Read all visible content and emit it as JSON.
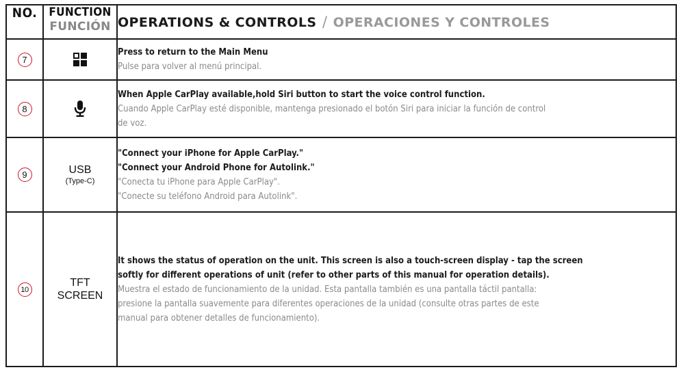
{
  "header": {
    "no": "NO.",
    "function_en": "FUNCTION",
    "function_es": "FUNCIÓN",
    "ops_en": "OPERATIONS & CONTROLS",
    "separator": "/",
    "ops_es": "OPERACIONES Y CONTROLES"
  },
  "rows": [
    {
      "number": "7",
      "function_icon": "main-menu-grid-icon",
      "lines_en": [
        "Press to return to the Main Menu"
      ],
      "lines_es": [
        "Pulse para volver al menú principal."
      ]
    },
    {
      "number": "8",
      "function_icon": "microphone-icon",
      "lines_en": [
        "When Apple CarPlay available,hold Siri button to start the voice control function."
      ],
      "lines_es": [
        "Cuando Apple CarPlay esté disponible, mantenga presionado el botón Siri para iniciar la función de control",
        "de voz."
      ]
    },
    {
      "number": "9",
      "function_main": "USB",
      "function_sub": "(Type-C)",
      "lines_en": [
        "\"Connect your iPhone for Apple CarPlay.\"",
        "\"Connect your Android Phone for Autolink.\""
      ],
      "lines_es": [
        "\"Conecta tu iPhone para Apple CarPlay\".",
        "\"Conecte su teléfono Android para Autolink\"."
      ]
    },
    {
      "number": "10",
      "function_main_1": "TFT",
      "function_main_2": "SCREEN",
      "lines_en": [
        "It shows the status of operation on the unit. This screen is also a touch-screen display - tap the screen",
        "softly for different operations of unit (refer to other parts of this manual for operation details)."
      ],
      "lines_es": [
        "Muestra el estado de funcionamiento de la unidad. Esta pantalla también es una pantalla táctil pantalla:",
        "presione la pantalla suavemente para diferentes operaciones de la unidad (consulte otras partes de este",
        "manual para obtener detalles de funcionamiento)."
      ]
    }
  ],
  "colors": {
    "number_circle": "#d0122a",
    "text_en": "#1c1c1c",
    "text_es": "#8a8a8a",
    "border": "#1a1a1a"
  }
}
